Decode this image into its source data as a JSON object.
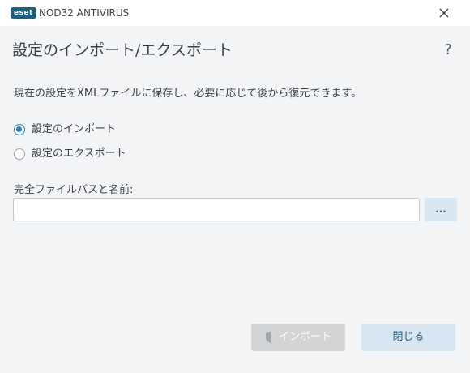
{
  "window": {
    "brand": "eset",
    "app_name": "NOD32 ANTIVIRUS"
  },
  "dialog": {
    "title": "設定のインポート/エクスポート",
    "help_label": "?",
    "description": "現在の設定をXMLファイルに保存し、必要に応じて後から復元できます。"
  },
  "options": {
    "import_label": "設定のインポート",
    "export_label": "設定のエクスポート",
    "selected": "import"
  },
  "path_field": {
    "label": "完全ファイルパスと名前:",
    "value": "",
    "browse_label": "..."
  },
  "buttons": {
    "import_label": "インポート",
    "import_enabled": false,
    "close_label": "閉じる"
  },
  "colors": {
    "accent": "#2d7fb1",
    "logo_bg": "#1f5f79",
    "button_bg": "#d7e6f1",
    "disabled_bg": "#d2d4d6"
  },
  "icons": {
    "close": "close-icon",
    "import": "shield-icon"
  }
}
